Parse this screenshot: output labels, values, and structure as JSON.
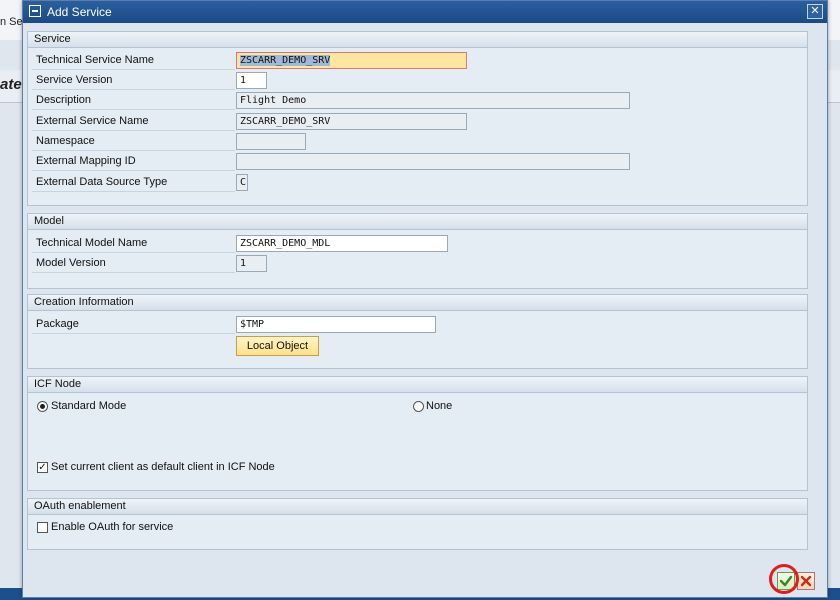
{
  "background": {
    "left_text": "n Se",
    "left_italic": "ate"
  },
  "dialog": {
    "title": "Add Service",
    "close_label": "✕"
  },
  "service": {
    "header": "Service",
    "technical_service_name_label": "Technical Service Name",
    "technical_service_name_value": "ZSCARR_DEMO_SRV",
    "service_version_label": "Service Version",
    "service_version_value": "1",
    "description_label": "Description",
    "description_value": "Flight Demo",
    "external_service_name_label": "External Service Name",
    "external_service_name_value": "ZSCARR_DEMO_SRV",
    "namespace_label": "Namespace",
    "namespace_value": "",
    "external_mapping_id_label": "External Mapping ID",
    "external_mapping_id_value": "",
    "external_data_source_type_label": "External Data Source Type",
    "external_data_source_type_value": "C"
  },
  "model": {
    "header": "Model",
    "technical_model_name_label": "Technical Model Name",
    "technical_model_name_value": "ZSCARR_DEMO_MDL",
    "model_version_label": "Model Version",
    "model_version_value": "1"
  },
  "creation": {
    "header": "Creation Information",
    "package_label": "Package",
    "package_value": "$TMP",
    "local_object_button": "Local Object"
  },
  "icf": {
    "header": "ICF Node",
    "standard_mode_label": "Standard Mode",
    "none_label": "None",
    "default_client_label": "Set current client as default client in ICF Node"
  },
  "oauth": {
    "header": "OAuth enablement",
    "enable_label": "Enable OAuth for service"
  },
  "colors": {
    "titlebar": "#1c4a85",
    "highlight_field": "#fde7a0",
    "local_object_button": "#ffe08a",
    "annotation": "#e41b1b"
  },
  "footer": {
    "ok_icon": "checkmark-icon",
    "cancel_icon": "cancel-x-icon"
  }
}
